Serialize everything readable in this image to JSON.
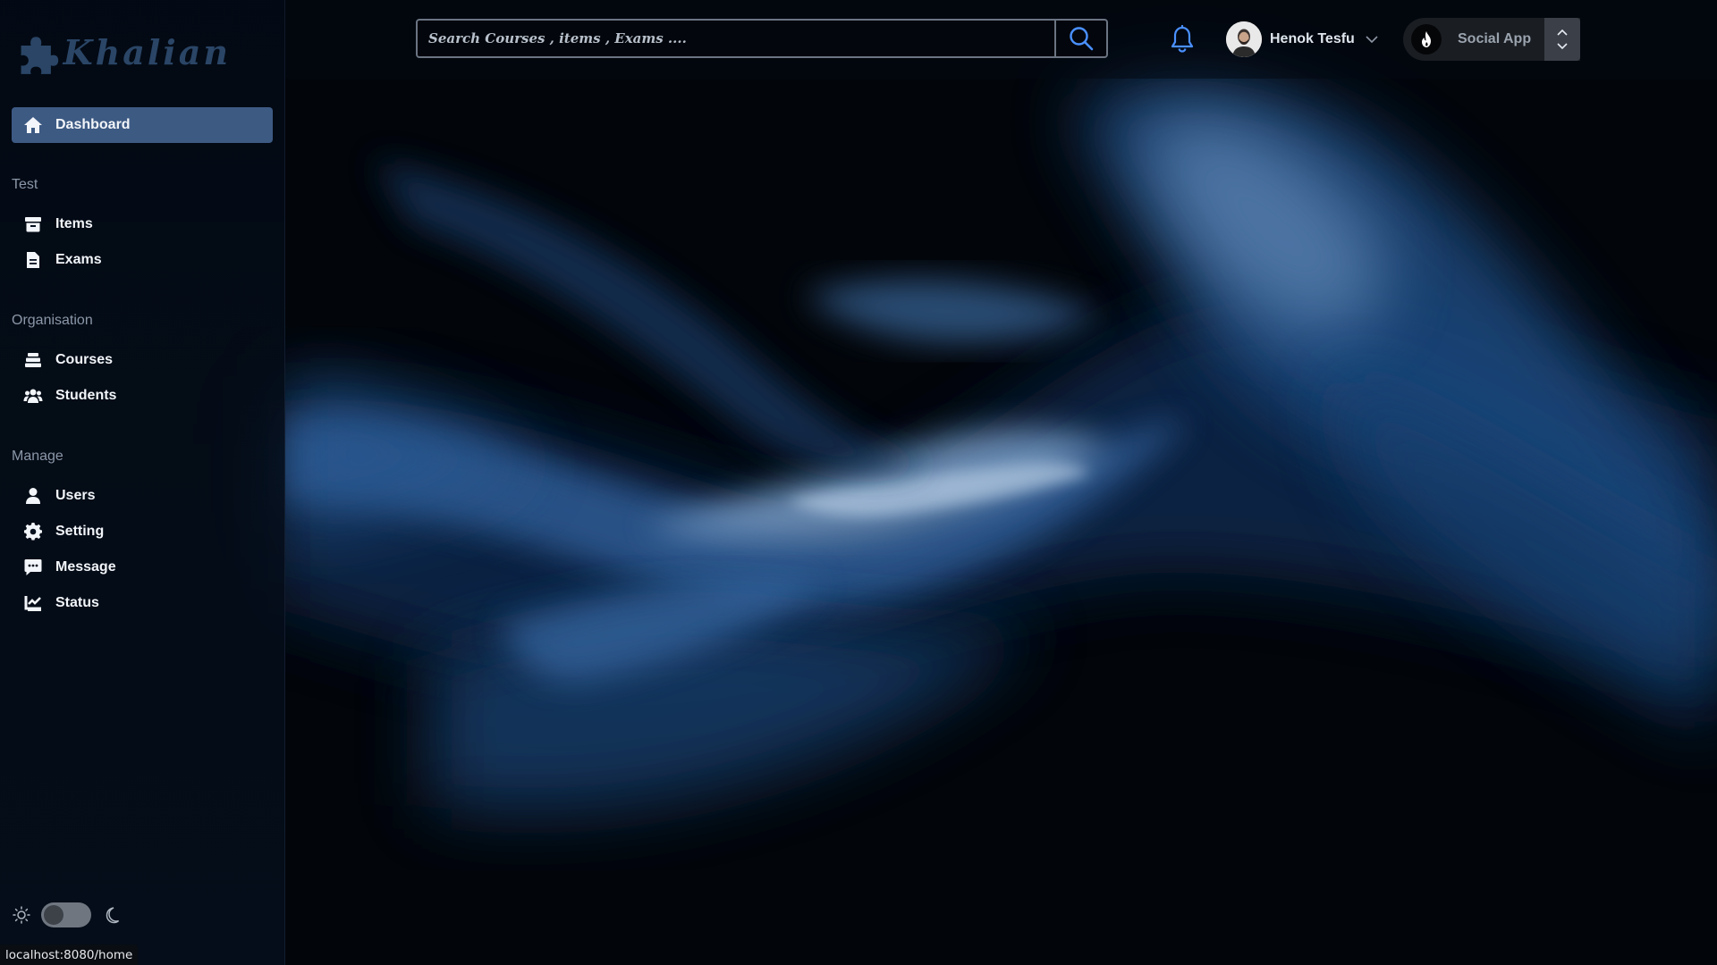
{
  "brand": {
    "name": "Khalian"
  },
  "sidebar": {
    "active": {
      "label": "Dashboard",
      "icon": "home-icon"
    },
    "sections": [
      {
        "title": "Test",
        "items": [
          {
            "label": "Items",
            "icon": "archive-box-icon"
          },
          {
            "label": "Exams",
            "icon": "file-document-icon"
          }
        ]
      },
      {
        "title": "Organisation",
        "items": [
          {
            "label": "Courses",
            "icon": "layers-icon"
          },
          {
            "label": "Students",
            "icon": "users-group-icon"
          }
        ]
      },
      {
        "title": "Manage",
        "items": [
          {
            "label": "Users",
            "icon": "user-icon"
          },
          {
            "label": "Setting",
            "icon": "gear-icon"
          },
          {
            "label": "Message",
            "icon": "chat-icon"
          },
          {
            "label": "Status",
            "icon": "chart-check-icon"
          }
        ]
      }
    ],
    "theme_toggle": {
      "state": "off",
      "left_icon": "sun-icon",
      "right_icon": "moon-icon"
    }
  },
  "header": {
    "search": {
      "placeholder": "Search Courses , items , Exams ...."
    },
    "user": {
      "name": "Henok Tesfu"
    },
    "app_switcher": {
      "name": "Social App",
      "icon": "flame-icon"
    }
  },
  "status_bar": {
    "url": "localhost:8080/home"
  },
  "colors": {
    "accent": "#3d5a83",
    "bell": "#4a90ff",
    "sidebar_bg": "#050e1c"
  }
}
